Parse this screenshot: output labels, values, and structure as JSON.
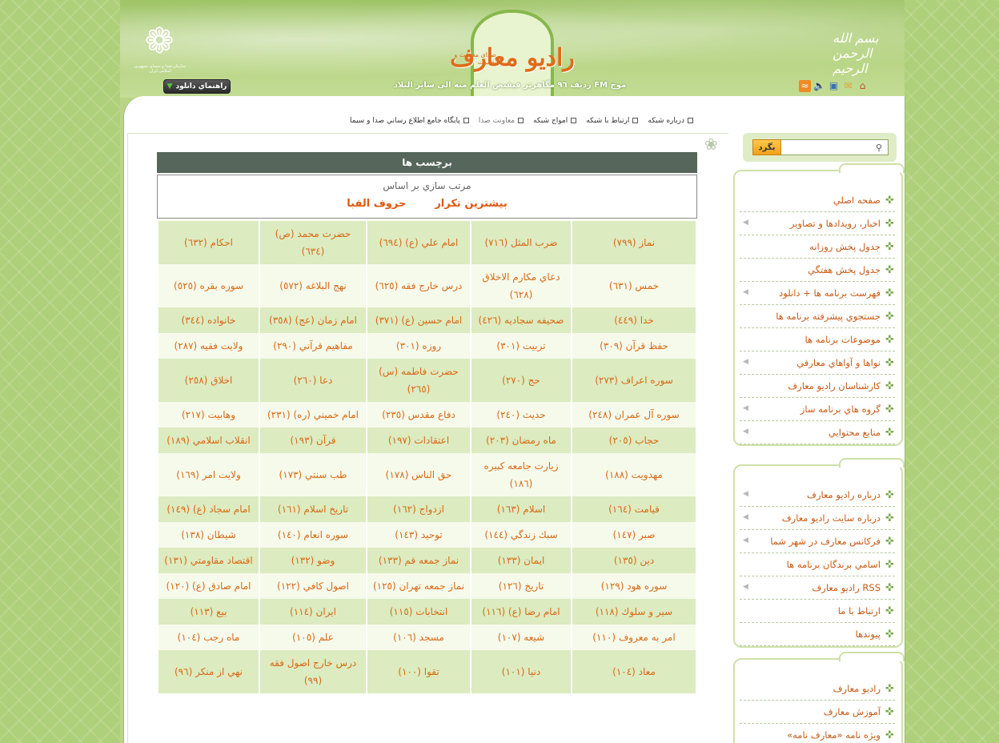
{
  "header": {
    "emblem_icon": "iribo-emblem-icon",
    "emblem_caption": "سازمان صدا و سیمای جمهوری اسلامی ایران",
    "calligraphy": "بسم الله الرحمن الرحیم",
    "logo_title": "راديو معارف",
    "logo_subtitle": "صدای معرفت و بصیرت",
    "fm_line": "موج FM رديف ٩٦ مگاهرتز    فيفيض العلم منه الى ساير البلاد",
    "help_button": "راهنماي دانلود",
    "icons": [
      "rss-icon",
      "speaker-icon",
      "sitemap-icon",
      "mail-icon",
      "home-icon"
    ]
  },
  "nav": {
    "items": [
      "درباره شبكه",
      "ارتباط با شبكه",
      "امواج شبكه",
      "معاونت صدا",
      "پايگاه جامع اطلاع رساني صدا و سيما"
    ]
  },
  "tags": {
    "title": "برچسب ها",
    "sort_label": "مرتب سازي بر اساس",
    "sort_options": [
      "بيشترين تكرار",
      "حروف الفبا"
    ],
    "rows": [
      [
        "نماز (٧٩٩)",
        "ضرب المثل (٧١٦)",
        "امام علي (ع) (٦٩٤)",
        "حضرت محمد (ص) (٦٣٤)",
        "احكام (٦٣٢)"
      ],
      [
        "خمس (٦٣١)",
        "دعاي مكارم الاخلاق (٦٢٨)",
        "درس خارج فقه (٦٢٥)",
        "نهج البلاغه (٥٧٢)",
        "سوره بقره (٥٢٥)"
      ],
      [
        "خدا (٤٤٩)",
        "صحيفه سجاديه (٤٢٦)",
        "امام حسين (ع) (٣٧١)",
        "امام زمان (عج) (٣٥٨)",
        "خانواده (٣٤٤)"
      ],
      [
        "حفظ قرآن (٣٠٩)",
        "تربيت (٣٠١)",
        "روزه (٣٠١)",
        "مفاهيم قرآني (٢٩٠)",
        "ولايت فقيه (٢٨٧)"
      ],
      [
        "سوره اعراف (٢٧٣)",
        "حج (٢٧٠)",
        "حضرت فاطمه (س) (٢٦٥)",
        "دعا (٢٦٠)",
        "اخلاق (٢٥٨)"
      ],
      [
        "سوره آل عمران (٢٤٨)",
        "حديث (٢٤٠)",
        "دفاع مقدس (٢٣٥)",
        "امام خميني (ره) (٢٣١)",
        "وهابيت (٢١٧)"
      ],
      [
        "حجاب (٢٠٥)",
        "ماه رمضان (٢٠٣)",
        "اعتقادات (١٩٧)",
        "قرآن (١٩٣)",
        "انقلاب اسلامي (١٨٩)"
      ],
      [
        "مهدويت (١٨٨)",
        "زيارت جامعه كبيره (١٨٦)",
        "حق الناس (١٧٨)",
        "طب سنتي (١٧٣)",
        "ولايت امر (١٦٩)"
      ],
      [
        "قيامت (١٦٤)",
        "اسلام (١٦٣)",
        "ازدواج (١٦٢)",
        "تاريخ اسلام (١٦١)",
        "امام سجاد (ع) (١٤٩)"
      ],
      [
        "صبر (١٤٧)",
        "سبك زندگي (١٤٤)",
        "توحيد (١٤٣)",
        "سوره انعام (١٤٠)",
        "شيطان (١٣٨)"
      ],
      [
        "دين (١٣٥)",
        "ايمان (١٣٣)",
        "نماز جمعه قم (١٣٣)",
        "وضو (١٣٢)",
        "اقتصاد مقاومتي (١٣١)"
      ],
      [
        "سوره هود (١٢٩)",
        "تاريخ (١٢٦)",
        "نماز جمعه تهران (١٢٥)",
        "اصول كافي (١٢٢)",
        "امام صادق (ع) (١٢٠)"
      ],
      [
        "سير و سلوك (١١٨)",
        "امام رضا (ع) (١١٦)",
        "انتخابات (١١٥)",
        "ايران (١١٤)",
        "بيع (١١٣)"
      ],
      [
        "امر به معروف (١١٠)",
        "شيعه (١٠٧)",
        "مسجد (١٠٦)",
        "علم (١٠٥)",
        "ماه رجب (١٠٤)"
      ],
      [
        "معاد (١٠٤)",
        "دنيا (١٠١)",
        "تقوا (١٠٠)",
        "درس خارج اصول فقه (٩٩)",
        "نهي از منكر (٩٦)"
      ]
    ]
  },
  "search": {
    "placeholder": "",
    "button": "بگرد"
  },
  "menu1": [
    {
      "label": "صفحه اصلي",
      "arrow": false
    },
    {
      "label": "اخبار، رويدادها و تصاوير",
      "arrow": true
    },
    {
      "label": "جدول پخش روزانه",
      "arrow": false
    },
    {
      "label": "جدول پخش هفتگي",
      "arrow": false
    },
    {
      "label": "فهرست برنامه ها + دانلود",
      "arrow": true
    },
    {
      "label": "جستجوي پيشرفته برنامه ها",
      "arrow": false
    },
    {
      "label": "موضوعات برنامه ها",
      "arrow": false
    },
    {
      "label": "نواها و آواهاي معارفي",
      "arrow": true
    },
    {
      "label": "كارشناسان راديو معارف",
      "arrow": false
    },
    {
      "label": "گروه هاي برنامه ساز",
      "arrow": true
    },
    {
      "label": "منابع محتوايي",
      "arrow": true
    }
  ],
  "menu2": [
    {
      "label": "درباره راديو معارف",
      "arrow": true
    },
    {
      "label": "درباره سايت راديو معارف",
      "arrow": true
    },
    {
      "label": "فركانس معارف در شهر شما",
      "arrow": true
    },
    {
      "label": "اسامي برندگان برنامه ها",
      "arrow": false
    },
    {
      "label": "RSS راديو معارف",
      "arrow": true
    },
    {
      "label": "ارتباط با ما",
      "arrow": false
    },
    {
      "label": "پيوندها",
      "arrow": false
    }
  ],
  "menu3": [
    {
      "label": "راديو معارف",
      "arrow": false
    },
    {
      "label": "آموزش معارف",
      "arrow": false
    },
    {
      "label": "ويژه نامه «معارف نامه»",
      "arrow": false
    }
  ],
  "colors": {
    "accent": "#d96a16",
    "header_bar": "#56665a",
    "row_odd": "#dcebc0",
    "row_even": "#f6faeb",
    "page_green": "#b9d486"
  }
}
